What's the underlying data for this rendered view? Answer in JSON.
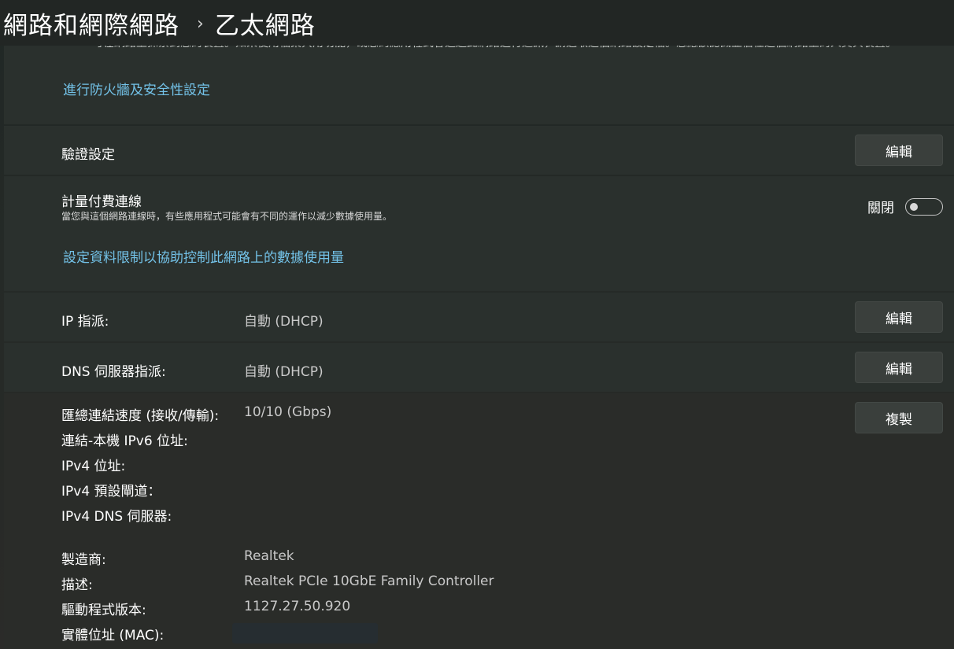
{
  "breadcrumb": {
    "root": "網路和網際網路",
    "separator": "›",
    "current": "乙太網路"
  },
  "firewall": {
    "cut_text": "可在網路上探索到您的裝置。如果使用檔案共用功能，或您的應用程式會透過此網路進行通訊，請選取這個網路設定檔。您應該認識並信任這個網路上的人員與裝置。",
    "link": "進行防火牆及安全性設定"
  },
  "auth": {
    "label": "驗證設定",
    "button": "編輯"
  },
  "metered": {
    "title": "計量付費連線",
    "description": "當您與這個網路連線時，有些應用程式可能會有不同的運作以減少數據使用量。",
    "toggle_state": "關閉",
    "toggle_on": false,
    "link": "設定資料限制以協助控制此網路上的數據使用量"
  },
  "ip": {
    "label": "IP 指派:",
    "value": "自動 (DHCP)",
    "button": "編輯"
  },
  "dns": {
    "label": "DNS 伺服器指派:",
    "value": "自動 (DHCP)",
    "button": "編輯"
  },
  "properties": {
    "copy_button": "複製",
    "rows": [
      {
        "label": "匯總連結速度 (接收/傳輸):",
        "value": "10/10 (Gbps)"
      },
      {
        "label": "連結-本機 IPv6 位址:",
        "value": ""
      },
      {
        "label": "IPv4 位址:",
        "value": ""
      },
      {
        "label": "IPv4 預設閘道：",
        "value": ""
      },
      {
        "label": "IPv4 DNS 伺服器:",
        "value": ""
      },
      {
        "label": "製造商:",
        "value": "Realtek"
      },
      {
        "label": "描述:",
        "value": "Realtek PCIe 10GbE Family Controller"
      },
      {
        "label": "驅動程式版本:",
        "value": "1127.27.50.920"
      },
      {
        "label": "實體位址 (MAC):",
        "value": ""
      }
    ]
  },
  "colors": {
    "link": "#73c2e8",
    "card": "#2a302d",
    "button": "#3a3f3c"
  }
}
